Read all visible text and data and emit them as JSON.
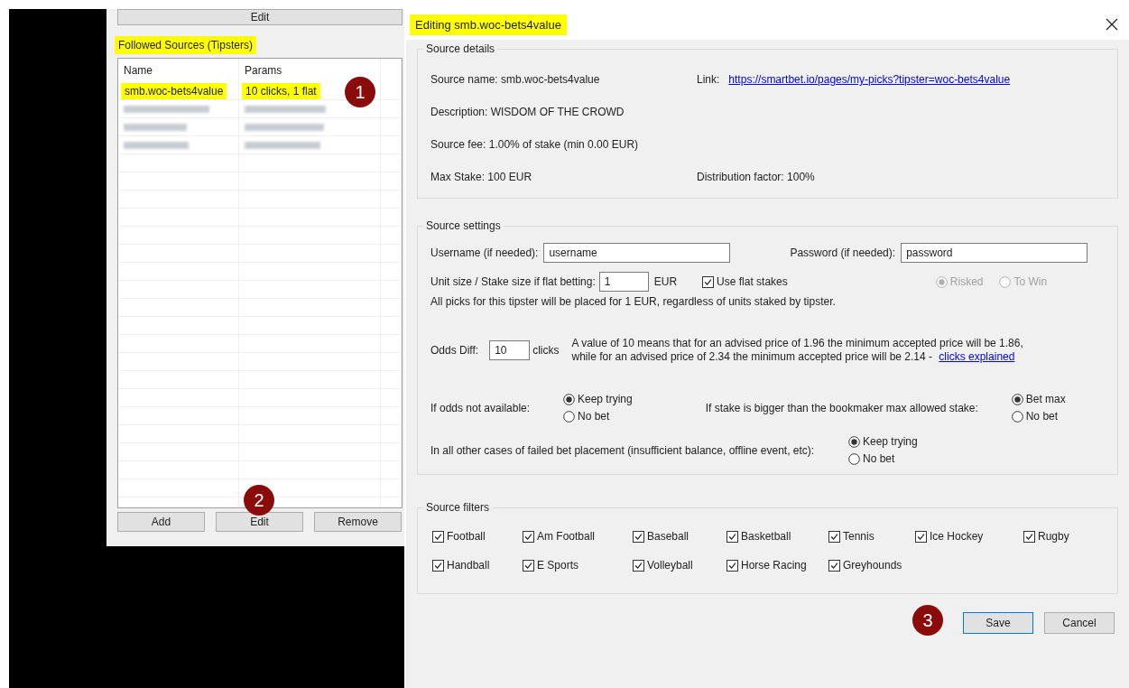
{
  "left_panel": {
    "top_button": "Edit",
    "group_title": "Followed Sources (Tipsters)",
    "group_title_highlighted": true,
    "table": {
      "columns": [
        "Name",
        "Params"
      ],
      "rows": [
        {
          "cells": [
            "smb.woc-bets4value",
            "10 clicks,  1 flat"
          ],
          "highlighted": true,
          "badge": "1"
        }
      ]
    },
    "buttons": [
      {
        "label": "Add"
      },
      {
        "label": "Edit",
        "badge": "2"
      },
      {
        "label": "Remove"
      }
    ]
  },
  "dialog": {
    "title": "Editing smb.woc-bets4value",
    "title_highlighted": true,
    "details": {
      "title": "Source details",
      "source_name": "Source name: smb.woc-bets4value",
      "link_label": "Link:",
      "link": "https://smartbet.io/pages/my-picks?tipster=woc-bets4value",
      "description": "Description: WISDOM OF THE CROWD",
      "fee": "Source fee: 1.00% of stake (min 0.00 EUR)",
      "max_stake": "Max Stake: 100 EUR",
      "distribution": "Distribution factor: 100%"
    },
    "settings": {
      "title": "Source settings",
      "username_label": "Username (if needed):",
      "username_value": "username",
      "password_label": "Password (if needed):",
      "password_value": "password",
      "unit_label": "Unit size / Stake size if flat betting:",
      "unit_value": "1",
      "unit_currency": "EUR",
      "flat_stakes": {
        "label": "Use flat stakes",
        "checked": true
      },
      "stake_mode": [
        {
          "label": "Risked",
          "selected": true,
          "disabled": true
        },
        {
          "label": "To Win",
          "selected": false,
          "disabled": true
        }
      ],
      "unit_note": "All picks for this tipster will be placed for 1 EUR, regardless of units staked by tipster.",
      "odds_label": "Odds Diff:",
      "odds_value": "10",
      "odds_unit": "clicks",
      "odds_note": "A value of 10 means that for an advised price of 1.96 the minimum accepted price will be 1.86,\nwhile for an advised price of 2.34 the minimum accepted price will be 2.14 - ",
      "odds_link": "clicks explained",
      "choices": [
        {
          "label": "If odds not available:",
          "options": [
            {
              "label": "Keep trying",
              "selected": true
            },
            {
              "label": "No bet",
              "selected": false
            }
          ]
        },
        {
          "label": "If stake is bigger than the bookmaker max allowed stake:",
          "options": [
            {
              "label": "Bet max",
              "selected": true
            },
            {
              "label": "No bet",
              "selected": false
            }
          ]
        },
        {
          "label": "In all other cases of failed bet placement (insufficient balance, offline event, etc):",
          "options": [
            {
              "label": "Keep trying",
              "selected": true
            },
            {
              "label": "No bet",
              "selected": false
            }
          ]
        }
      ]
    },
    "filters": {
      "title": "Source filters",
      "items": [
        {
          "label": "Football",
          "checked": true
        },
        {
          "label": "Am Football",
          "checked": true
        },
        {
          "label": "Baseball",
          "checked": true
        },
        {
          "label": "Basketball",
          "checked": true
        },
        {
          "label": "Tennis",
          "checked": true
        },
        {
          "label": "Ice Hockey",
          "checked": true
        },
        {
          "label": "Rugby",
          "checked": true
        },
        {
          "label": "Handball",
          "checked": true
        },
        {
          "label": "E Sports",
          "checked": true
        },
        {
          "label": "Volleyball",
          "checked": true
        },
        {
          "label": "Horse Racing",
          "checked": true
        },
        {
          "label": "Greyhounds",
          "checked": true
        }
      ]
    },
    "buttons": [
      {
        "label": "Save",
        "default": true,
        "badge": "3"
      },
      {
        "label": "Cancel",
        "default": false
      }
    ]
  }
}
